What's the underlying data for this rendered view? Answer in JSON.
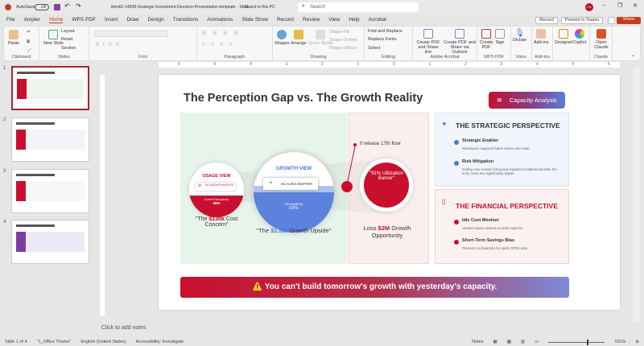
{
  "titlebar": {
    "autosave": "AutoSave",
    "autosave_state": "Off",
    "filename": "itemID-14008-Strategic-Investment-Decision-Presentation-template - 16x9...",
    "saved": "• Saved to this PC",
    "search_placeholder": "Search",
    "avatar": "LS"
  },
  "tabs": [
    "File",
    "Ampler",
    "Home",
    "WPS PDF",
    "Insert",
    "Draw",
    "Design",
    "Transitions",
    "Animations",
    "Slide Show",
    "Record",
    "Review",
    "View",
    "Help",
    "Acrobat"
  ],
  "active_tab": "Home",
  "top_buttons": {
    "record": "Record",
    "present": "Present in Teams",
    "share": "Share"
  },
  "ribbon": {
    "clipboard": {
      "label": "Clipboard",
      "paste": "Paste"
    },
    "slides": {
      "label": "Slides",
      "new_slide": "New Slide",
      "layout": "Layout",
      "reset": "Reset",
      "section": "Section"
    },
    "font": {
      "label": "Font"
    },
    "paragraph": {
      "label": "Paragraph"
    },
    "drawing": {
      "label": "Drawing",
      "shapes": "Shapes",
      "arrange": "Arrange",
      "quick_styles": "Quick Styles",
      "shape_fill": "Shape Fill",
      "shape_outline": "Shape Outline",
      "shape_effects": "Shape Effects"
    },
    "editing": {
      "label": "Editing",
      "find": "Find and Replace",
      "replace_fonts": "Replace Fonts",
      "select": "Select"
    },
    "acrobat": {
      "label": "Adobe Acrobat",
      "create_share": "Create PDF and Share link",
      "create_outlook": "Create PDF and Share via Outlook"
    },
    "wps": {
      "label": "WPS PDF",
      "create": "Create PDF",
      "sign": "Sign"
    },
    "voice": {
      "label": "Voice",
      "dictate": "Dictate"
    },
    "addins": {
      "label": "Add-ins",
      "addins": "Add-ins"
    },
    "designer": "Designer",
    "copilot": "Copilot",
    "claude": {
      "label": "Claude",
      "open": "Open Claude"
    }
  },
  "ruler_ticks": [
    "6",
    "5",
    "4",
    "3",
    "2",
    "1",
    "0",
    "1",
    "2",
    "3",
    "4",
    "5",
    "6"
  ],
  "thumbnails": [
    "1",
    "2",
    "3",
    "4"
  ],
  "slide": {
    "title": "The Perception Gap vs. The Growth Reality",
    "badge": "Capacity Analysis",
    "usage": {
      "title": "USAGE VIEW",
      "buffer": "NO GROWTH BUFFER",
      "occ": "Current Occupancy",
      "occ_val": "58%",
      "cap_pre": "\"The ",
      "cap_hl": "$130k",
      "cap_post": " Cost Concern\""
    },
    "growth": {
      "title": "GROWTH VIEW",
      "buffer": "SCALING BUFFER",
      "occ": "Occupancy",
      "occ_val": "XX%",
      "cap_pre": "\"The ",
      "cap_hl": "$1.5M",
      "cap_post": " Growth Upside\""
    },
    "barrier": {
      "note": "if release 17th floor",
      "text": "\"91% Utilization Barrier\"",
      "cap_pre": "Loss ",
      "cap_hl": "$2M",
      "cap_post": " Growth Opportunity"
    },
    "strategic": {
      "title": "THE STRATEGIC PERSPECTIVE",
      "items": [
        {
          "t": "Strategic Enabler",
          "d": "Workspace supports future teams and scale"
        },
        {
          "t": "Risk Mitigation",
          "d": "Exiting now creates hiring and expansion bottlenecks later Re-entry costs are significantly higher"
        }
      ]
    },
    "financial": {
      "title": "THE FINANCIAL PERSPECTIVE",
      "items": [
        {
          "t": "Idle Cost Mindset",
          "d": "Unused space viewed as sunk expense"
        },
        {
          "t": "Short-Term Savings Bias",
          "d": "Pressure to downsize for quick OPEX wins"
        }
      ]
    },
    "banner": "⚠️ You can't build tomorrow's growth with yesterday's capacity."
  },
  "notes_placeholder": "Click to add notes",
  "status": {
    "slide": "Slide 1 of 4",
    "theme": "\"1_Office Theme\"",
    "lang": "English (United States)",
    "access": "Accessibility: Investigate",
    "notes": "Notes",
    "zoom": "101%"
  },
  "colors": {
    "accent_red": "#c8102e",
    "blue": "#4a78d8",
    "share": "#c43e1c"
  }
}
